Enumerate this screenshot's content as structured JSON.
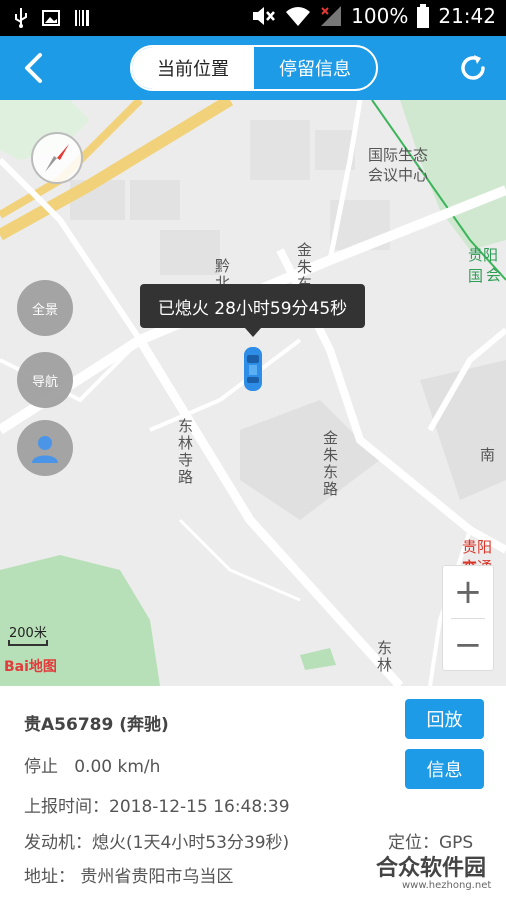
{
  "status_bar": {
    "battery": "100%",
    "time": "21:42"
  },
  "header": {
    "tabs": [
      {
        "label": "当前位置",
        "active": true
      },
      {
        "label": "停留信息",
        "active": false
      }
    ]
  },
  "map": {
    "labels": {
      "poi_1": "国际生态",
      "poi_1b": "会议中心",
      "poi_2": "贵阳国",
      "poi_2b": "会",
      "road_1": "金朱东路",
      "road_2": "东林寺路",
      "road_3": "金朱东路",
      "road_4": "黔北路",
      "road_5": "南",
      "road_6": "东林",
      "poi_3": "贵阳市",
      "poi_3b": "交通管"
    },
    "side_buttons": {
      "overview": "全景",
      "navigate": "导航"
    },
    "tooltip": "已熄火 28小时59分45秒",
    "scale": "200米",
    "logo": "Bai地图",
    "zoom_in": "+",
    "zoom_out": "−"
  },
  "info": {
    "plate": "贵A56789 (奔驰)",
    "status": "停止",
    "speed": "0.00 km/h",
    "report_time": "上报时间：2018-12-15 16:48:39",
    "engine": "发动机：熄火(1天4小时53分39秒)",
    "locate": "定位：GPS",
    "address": "地址： 贵州省贵阳市乌当区",
    "btn_replay": "回放",
    "btn_info": "信息"
  },
  "watermark": {
    "title": "合众软件园",
    "url": "www.hezhong.net"
  },
  "colors": {
    "primary": "#1e9be6",
    "tooltip_bg": "#333333"
  }
}
